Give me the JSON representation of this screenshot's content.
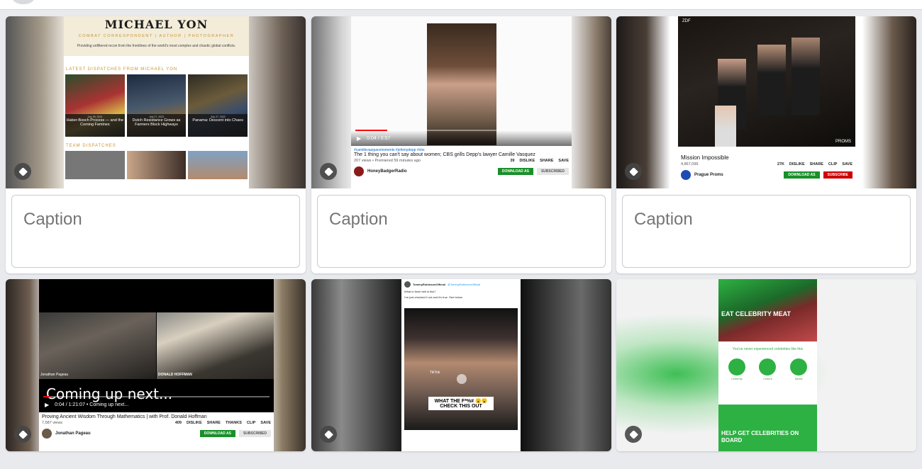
{
  "caption_placeholder": "Caption",
  "cards": [
    {
      "site_title": "MICHAEL YON",
      "site_tagline": "COMBAT CORRESPONDENT | AUTHOR | PHOTOGRAPHER",
      "site_blurb": "Providing unfiltered recon from the frontlines of the world's most complex and chaotic global conflicts.",
      "section1": "LATEST DISPATCHES FROM MICHAEL YON",
      "posts": [
        {
          "date": "July 28, 2023",
          "title": "Haber-Bosch Process — and the Coming Famines"
        },
        {
          "date": "July 27, 2023",
          "title": "Dutch Resistance Grows as Farmers Block Highways"
        },
        {
          "date": "July 27, 2023",
          "title": "Panama: Descent into Chaos"
        }
      ],
      "section2": "TEAM DISPATCHES"
    },
    {
      "time": "0:04 / 0:57",
      "hashtags": "#camillevasquezmoments #johnnydepp #cbs",
      "title": "The 1 thing you can't say about women; CBS grills Depp's lawyer Camille Vasquez",
      "stats": "207 views • Premiered 59 minutes ago",
      "likes": "39",
      "actions": [
        "DISLIKE",
        "SHARE",
        "SAVE"
      ],
      "channel": "HoneyBadgerRadio",
      "download": "DOWNLOAD AS",
      "subscribed": "SUBSCRIBED"
    },
    {
      "overlay_tl": "ZDF",
      "overlay_br": "PROMS",
      "title": "Mission Impossible",
      "views": "4,867,099",
      "likes": "27K",
      "actions": [
        "DISLIKE",
        "SHARE",
        "CLIP",
        "SAVE"
      ],
      "channel": "Prague Proms",
      "download": "DOWNLOAD AS",
      "subscribe": "SUBSCRIBE"
    },
    {
      "time": "0:04 / 1:21:07 • Coming up next...",
      "overlay_text": "Coming up next...",
      "name_left": "Jonathan Pageau",
      "name_right": "DONALD HOFFMAN",
      "title": "Proving Ancient Wisdom Through Mathematics | with Prof. Donald Hoffman",
      "views": "7,587 views",
      "likes": "409",
      "actions": [
        "DISLIKE",
        "SHARE",
        "THANKS",
        "CLIP",
        "SAVE"
      ],
      "channel": "Jonathan Pageau",
      "download": "DOWNLOAD AS",
      "subscribed": "SUBSCRIBED"
    },
    {
      "account": "TommyRobinsonOfficial",
      "handle": "@TommyRobinsonOfficial",
      "tweet1": "What in fresh hell is this?",
      "tweet2": "I've just checked it out and it's true. See below.",
      "caption": "WHAT THE F*%# 😮😮 CHECK THIS OUT",
      "tiktok": "TikTok"
    },
    {
      "hero": "EAT CELEBRITY MEAT",
      "subhead": "You've never experienced celebrities like this",
      "features": [
        "Celebrity",
        "Culture",
        "Meats"
      ],
      "footer": "HELP GET CELEBRITIES ON BOARD"
    }
  ],
  "colors": {
    "page_bg": "#e9eaed",
    "card_bg": "#ffffff",
    "yon_gold": "#c9952e",
    "yt_red": "#ff0000",
    "download_green": "#1a8f2a",
    "meat_green": "#2db142"
  }
}
